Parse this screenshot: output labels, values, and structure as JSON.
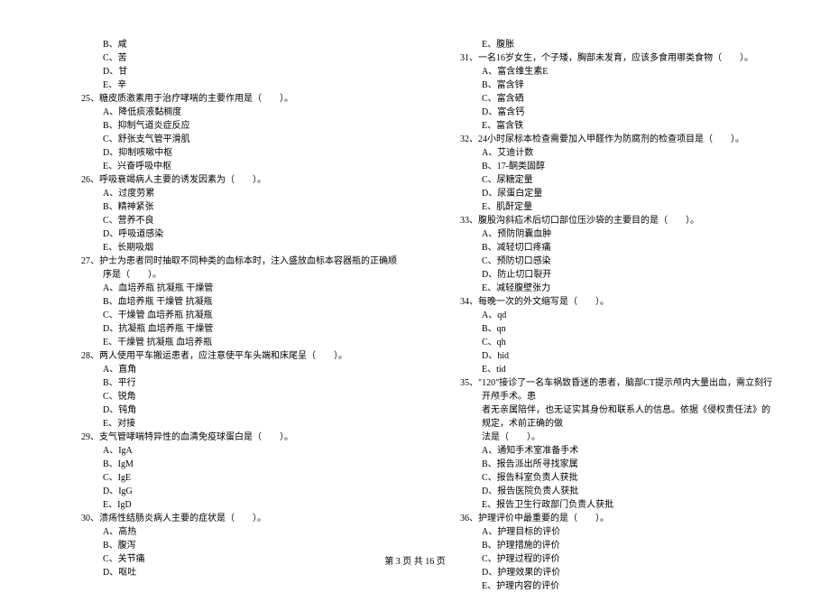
{
  "left": {
    "pre_options": [
      "B、咸",
      "C、苦",
      "D、甘",
      "E、辛"
    ],
    "q25": {
      "text": "25、糖皮质激素用于治疗哮喘的主要作用是（　　）。",
      "opts": [
        "A、降低痰液黏稠度",
        "B、抑制气道炎症反应",
        "C、舒张支气管平滑肌",
        "D、抑制咳嗽中枢",
        "E、兴奋呼吸中枢"
      ]
    },
    "q26": {
      "text": "26、呼吸衰竭病人主要的诱发因素为（　　）。",
      "opts": [
        "A、过度劳累",
        "B、精神紧张",
        "C、营养不良",
        "D、呼吸道感染",
        "E、长期吸烟"
      ]
    },
    "q27": {
      "text": "27、护士为患者同时抽取不同种类的血标本时，注入盛放血标本容器瓶的正确顺序是（　　）。",
      "opts": [
        "A、血培养瓶 抗凝瓶 干燥管",
        "B、血培养瓶 干燥管 抗凝瓶",
        "C、干燥管 血培养瓶 抗凝瓶",
        "D、抗凝瓶 血培养瓶 干燥管",
        "E、干燥管 抗凝瓶 血培养瓶"
      ]
    },
    "q28": {
      "text": "28、两人使用平车搬运患者，应注意使平车头端和床尾呈（　　）。",
      "opts": [
        "A、直角",
        "B、平行",
        "C、锐角",
        "D、钝角",
        "E、对接"
      ]
    },
    "q29": {
      "text": "29、支气管哮喘特异性的血清免疫球蛋白是（　　）。",
      "opts": [
        "A、IgA",
        "B、IgM",
        "C、IgE",
        "D、IgG",
        "E、IgD"
      ]
    },
    "q30": {
      "text": "30、溃疡性结肠炎病人主要的症状是（　　）。",
      "opts": [
        "A、高热",
        "B、腹泻",
        "C、关节痛",
        "D、呕吐"
      ]
    }
  },
  "right": {
    "pre_options": [
      "E、腹胀"
    ],
    "q31": {
      "text": "31、一名16岁女生，个子矮，胸部未发育，应该多食用哪类食物（　　）。",
      "opts": [
        "A、富含维生素E",
        "B、富含锌",
        "C、富含硒",
        "D、富含钙",
        "E、富含铁"
      ]
    },
    "q32": {
      "text": "32、24小时尿标本检查需要加入甲醛作为防腐剂的检查项目是（　　）。",
      "opts": [
        "A、艾迪计数",
        "B、17-酮类固醇",
        "C、尿糖定量",
        "D、尿蛋白定量",
        "E、肌酐定量"
      ]
    },
    "q33": {
      "text": "33、腹股沟斜疝术后切口部位压沙袋的主要目的是（　　）。",
      "opts": [
        "A、预防阴囊血肿",
        "B、减轻切口疼痛",
        "C、预防切口感染",
        "D、防止切口裂开",
        "E、减轻腹壁张力"
      ]
    },
    "q34": {
      "text": "34、每晚一次的外文缩写是（　　）。",
      "opts": [
        "A、qd",
        "B、qn",
        "C、qh",
        "D、hid",
        "E、tid"
      ]
    },
    "q35": {
      "line1": "35、\"120\"接诊了一名车祸致昏迷的患者，脑部CT提示颅内大量出血，需立刻行开颅手术。患",
      "line2": "者无亲属陪伴，也无证实其身份和联系人的信息。依据《侵权责任法》的规定，术前正确的做",
      "line3": "法是（　　）。",
      "opts": [
        "A、通知手术室准备手术",
        "B、报告派出所寻找家属",
        "C、报告科室负责人获批",
        "D、报告医院负责人获批",
        "E、报告卫生行政部门负责人获批"
      ]
    },
    "q36": {
      "text": "36、护理评价中最重要的是（　　）。",
      "opts": [
        "A、护理目标的评价",
        "B、护理措施的评价",
        "C、护理过程的评价",
        "D、护理效果的评价",
        "E、护理内容的评价"
      ]
    }
  },
  "footer": "第 3 页 共 16 页"
}
